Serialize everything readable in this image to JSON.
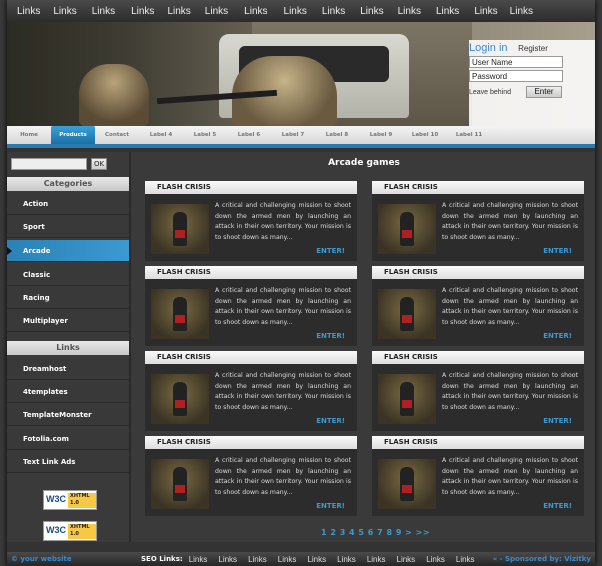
{
  "top_links": [
    "Links",
    "Links",
    "Links",
    "Links",
    "Links",
    "Links",
    "Links",
    "Links",
    "Links",
    "Links",
    "Links",
    "Links",
    "Links",
    "Links"
  ],
  "login": {
    "title": "Login in",
    "register": "Register",
    "username_value": "User Name",
    "password_value": "Password",
    "leave_label": "Leave behind",
    "enter_label": "Enter"
  },
  "nav": [
    "Home",
    "Products",
    "Contact",
    "Label 4",
    "Label 5",
    "Label 6",
    "Label 7",
    "Label 8",
    "Label 9",
    "Label 10",
    "Label 11"
  ],
  "sidebar": {
    "search_ok": "OK",
    "categories_heading": "Categories",
    "categories": [
      "Action",
      "Sport",
      "Arcade",
      "Classic",
      "Racing",
      "Multiplayer"
    ],
    "links_heading": "Links",
    "links": [
      "Dreamhost",
      "4templates",
      "TemplateMonster",
      "Fotolia.com",
      "Text Link Ads"
    ],
    "badges": [
      {
        "left": "W3C",
        "right": "XHTML 1.0"
      },
      {
        "left": "W3C",
        "right": "XHTML 1.0"
      }
    ]
  },
  "main": {
    "title": "Arcade games",
    "cards": [
      {
        "title": "FLASH CRISIS",
        "text": "A critical and challenging mission to shoot down the armed men by launching an attack in their own territory. Your mission is to shoot down as many...",
        "enter": "ENTER!"
      },
      {
        "title": "FLASH CRISIS",
        "text": "A critical and challenging mission to shoot down the armed men by launching an attack in their own territory. Your mission is to shoot down as many...",
        "enter": "ENTER!"
      },
      {
        "title": "FLASH CRISIS",
        "text": "A critical and challenging mission to shoot down the armed men by launching an attack in their own territory. Your mission is to shoot down as many...",
        "enter": "ENTER!"
      },
      {
        "title": "FLASH CRISIS",
        "text": "A critical and challenging mission to shoot down the armed men by launching an attack in their own territory. Your mission is to shoot down as many...",
        "enter": "ENTER!"
      },
      {
        "title": "FLASH CRISIS",
        "text": "A critical and challenging mission to shoot down the armed men by launching an attack in their own territory. Your mission is to shoot down as many...",
        "enter": "ENTER!"
      },
      {
        "title": "FLASH CRISIS",
        "text": "A critical and challenging mission to shoot down the armed men by launching an attack in their own territory. Your mission is to shoot down as many...",
        "enter": "ENTER!"
      },
      {
        "title": "FLASH CRISIS",
        "text": "A critical and challenging mission to shoot down the armed men by launching an attack in their own territory. Your mission is to shoot down as many...",
        "enter": "ENTER!"
      },
      {
        "title": "FLASH CRISIS",
        "text": "A critical and challenging mission to shoot down the armed men by launching an attack in their own territory. Your mission is to shoot down as many...",
        "enter": "ENTER!"
      }
    ],
    "pager": "1 2 3 4 5 6 7 8 9 > >>"
  },
  "footer": {
    "left": "© your website",
    "seo_label": "SEO Links:",
    "links": [
      "Links",
      "Links",
      "Links",
      "Links",
      "Links",
      "Links",
      "Links",
      "Links",
      "Links",
      "Links"
    ],
    "right": "« - Sponsored by: Vizitky"
  }
}
